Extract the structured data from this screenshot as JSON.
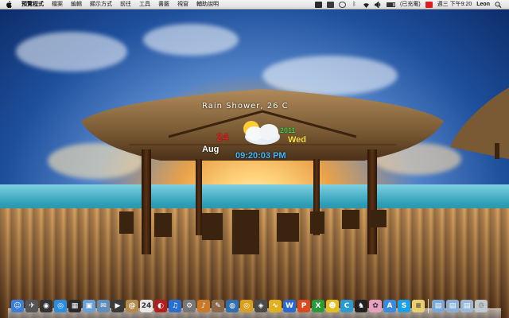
{
  "menubar": {
    "app_name": "預覽程式",
    "menus": [
      "檔案",
      "編輯",
      "顯示方式",
      "前往",
      "工具",
      "書籤",
      "視窗",
      "輔助說明"
    ],
    "status": {
      "battery_label": "(已充電)",
      "clock": "週三 下午9:20",
      "user": "Leon"
    }
  },
  "weather_widget": {
    "condition": "Rain Shower, 26 C",
    "day": "24",
    "month": "Aug",
    "year": "2011",
    "weekday": "Wed",
    "time": "09:20:03 PM",
    "colors": {
      "day": "#e02020",
      "year": "#39d14a",
      "weekday": "#ffe640",
      "time": "#40b8ff"
    },
    "icon": "rain-shower-weather-icon"
  },
  "dock": {
    "apps": [
      {
        "name": "finder-icon",
        "glyph": "☺",
        "color": "#3c7fd8"
      },
      {
        "name": "launchpad-icon",
        "glyph": "✈",
        "color": "#555"
      },
      {
        "name": "dashboard-icon",
        "glyph": "◉",
        "color": "#333"
      },
      {
        "name": "safari-icon",
        "glyph": "◎",
        "color": "#2a8de0"
      },
      {
        "name": "mission-control-icon",
        "glyph": "▦",
        "color": "#2b2b2b"
      },
      {
        "name": "preview-icon",
        "glyph": "▣",
        "color": "#6aa0d8"
      },
      {
        "name": "mail-icon",
        "glyph": "✉",
        "color": "#5f8fb8"
      },
      {
        "name": "facetime-icon",
        "glyph": "▶",
        "color": "#3a3a3a"
      },
      {
        "name": "contacts-icon",
        "glyph": "@",
        "color": "#b48a4e"
      },
      {
        "name": "calendar-icon",
        "glyph": "24",
        "color": "#e8e8e8"
      },
      {
        "name": "photo-booth-icon",
        "glyph": "◐",
        "color": "#b02020"
      },
      {
        "name": "itunes-icon",
        "glyph": "♫",
        "color": "#2a6ed0"
      },
      {
        "name": "system-preferences-icon",
        "glyph": "⚙",
        "color": "#777"
      },
      {
        "name": "garageband-icon",
        "glyph": "♪",
        "color": "#c87a2a"
      },
      {
        "name": "pen-tool-icon",
        "glyph": "✎",
        "color": "#8a6a4a"
      },
      {
        "name": "web-globe-icon",
        "glyph": "◍",
        "color": "#2f6fb0"
      },
      {
        "name": "chrome-icon",
        "glyph": "◎",
        "color": "#d8a020"
      },
      {
        "name": "activity-monitor-icon",
        "glyph": "◈",
        "color": "#4a4a4a"
      },
      {
        "name": "fish-icon",
        "glyph": "∿",
        "color": "#e0b020"
      },
      {
        "name": "word-icon",
        "glyph": "W",
        "color": "#2a6ad0"
      },
      {
        "name": "powerpoint-icon",
        "glyph": "P",
        "color": "#d84a20"
      },
      {
        "name": "excel-icon",
        "glyph": "X",
        "color": "#2a9a3a"
      },
      {
        "name": "smiley-icon",
        "glyph": "☻",
        "color": "#e0c020"
      },
      {
        "name": "calculator-icon",
        "glyph": "C",
        "color": "#2a9ad0"
      },
      {
        "name": "qq-penguin-icon",
        "glyph": "♞",
        "color": "#222"
      },
      {
        "name": "sketch-icon",
        "glyph": "✿",
        "color": "#e8a0c0"
      },
      {
        "name": "app-store-icon",
        "glyph": "A",
        "color": "#3a8ae0"
      },
      {
        "name": "skype-icon",
        "glyph": "S",
        "color": "#1aa0e8"
      },
      {
        "name": "notes-icon",
        "glyph": "≡",
        "color": "#e8d070"
      }
    ],
    "stacks": [
      {
        "name": "applications-folder-icon",
        "glyph": "▤",
        "color": "#7aa8d8"
      },
      {
        "name": "documents-folder-icon",
        "glyph": "▤",
        "color": "#8ab0d8"
      },
      {
        "name": "downloads-folder-icon",
        "glyph": "▤",
        "color": "#9ab8d8"
      },
      {
        "name": "trash-icon",
        "glyph": "♲",
        "color": "#c0c8d0"
      }
    ]
  }
}
